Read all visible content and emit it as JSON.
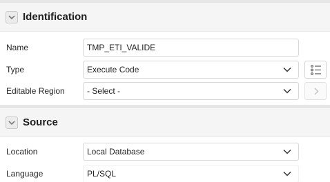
{
  "sections": {
    "identification": {
      "title": "Identification",
      "fields": {
        "name": {
          "label": "Name",
          "value": "TMP_ETI_VALIDE"
        },
        "type": {
          "label": "Type",
          "value": "Execute Code"
        },
        "editable_region": {
          "label": "Editable Region",
          "value": "- Select -"
        }
      }
    },
    "source": {
      "title": "Source",
      "fields": {
        "location": {
          "label": "Location",
          "value": "Local Database"
        },
        "language": {
          "label": "Language",
          "value": "PL/SQL"
        }
      }
    }
  },
  "icons": {
    "toggle": "chevron-down-icon",
    "select": "chevron-down-icon",
    "list_of_values": "list-icon",
    "go_to": "chevron-right-icon"
  },
  "colors": {
    "header_bg": "#f5f5f5",
    "divider": "#e6e6e6",
    "field_border": "#d7d7d7",
    "text": "#262626"
  }
}
